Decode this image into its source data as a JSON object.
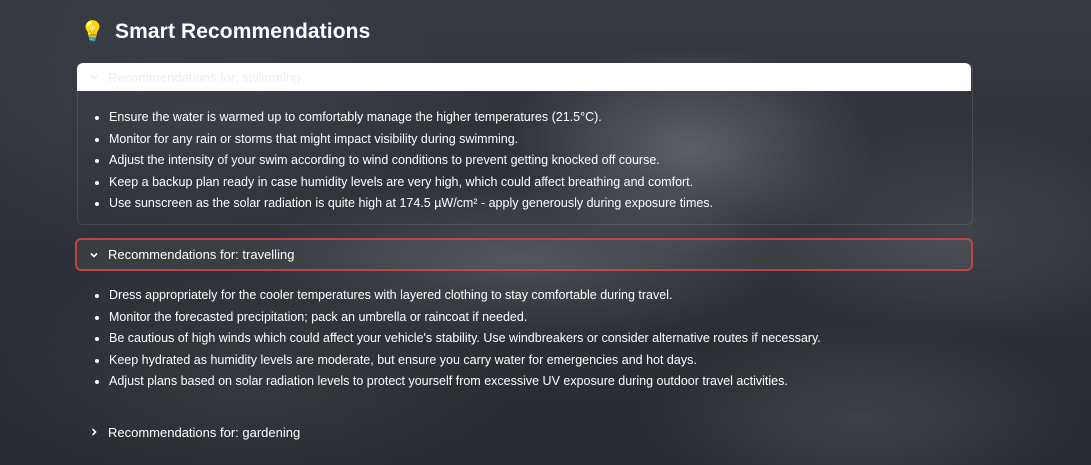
{
  "page": {
    "title": "Smart Recommendations",
    "title_icon": "lightbulb-icon"
  },
  "sections": [
    {
      "label": "Recommendations for: swimming",
      "expanded": true,
      "items": [
        "Ensure the water is warmed up to comfortably manage the higher temperatures (21.5°C).",
        "Monitor for any rain or storms that might impact visibility during swimming.",
        "Adjust the intensity of your swim according to wind conditions to prevent getting knocked off course.",
        "Keep a backup plan ready in case humidity levels are very high, which could affect breathing and comfort.",
        "Use sunscreen as the solar radiation is quite high at 174.5 µW/cm² - apply generously during exposure times."
      ]
    },
    {
      "label": "Recommendations for: travelling",
      "expanded": true,
      "items": [
        "Dress appropriately for the cooler temperatures with layered clothing to stay comfortable during travel.",
        "Monitor the forecasted precipitation; pack an umbrella or raincoat if needed.",
        "Be cautious of high winds which could affect your vehicle's stability. Use windbreakers or consider alternative routes if necessary.",
        "Keep hydrated as humidity levels are moderate, but ensure you carry water for emergencies and hot days.",
        "Adjust plans based on solar radiation levels to protect yourself from excessive UV exposure during outdoor travel activities."
      ]
    },
    {
      "label": "Recommendations for: gardening",
      "expanded": false,
      "items": []
    }
  ],
  "colors": {
    "focus_border": "#d6434f",
    "text": "#ffffff"
  }
}
